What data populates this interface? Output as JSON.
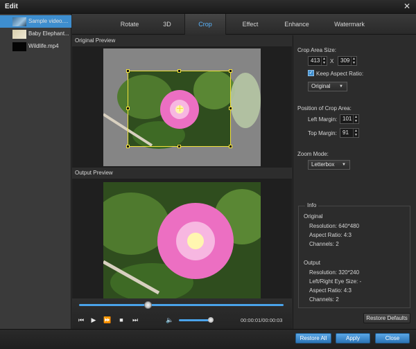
{
  "window": {
    "title": "Edit"
  },
  "files": [
    {
      "name": "Sample video....",
      "selected": true
    },
    {
      "name": "Baby Elephant...",
      "selected": false
    },
    {
      "name": "Wildlife.mp4",
      "selected": false
    }
  ],
  "tabs": [
    "Rotate",
    "3D",
    "Crop",
    "Effect",
    "Enhance",
    "Watermark"
  ],
  "preview": {
    "original_label": "Original Preview",
    "output_label": "Output Preview"
  },
  "player": {
    "time": "00:00:01/00:00:03",
    "progress": 0.33,
    "volume": 0.9
  },
  "crop": {
    "size_label": "Crop Area Size:",
    "width": "413",
    "x_sep": "X",
    "height": "309",
    "keep_aspect_label": "Keep Aspect Ratio:",
    "keep_aspect_checked": true,
    "aspect_mode": "Original",
    "position_label": "Position of Crop Area:",
    "left_margin_label": "Left Margin:",
    "left_margin": "101",
    "top_margin_label": "Top Margin:",
    "top_margin": "91",
    "zoom_label": "Zoom Mode:",
    "zoom_mode": "Letterbox"
  },
  "info": {
    "title": "Info",
    "original_head": "Original",
    "original_resolution": "Resolution: 640*480",
    "original_aspect": "Aspect Ratio: 4:3",
    "original_channels": "Channels: 2",
    "output_head": "Output",
    "output_resolution": "Resolution: 320*240",
    "output_eye": "Left/Right Eye Size: -",
    "output_aspect": "Aspect Ratio: 4:3",
    "output_channels": "Channels: 2"
  },
  "buttons": {
    "restore_defaults": "Restore Defaults",
    "restore_all": "Restore All",
    "apply": "Apply",
    "close": "Close"
  },
  "colors": {
    "accent": "#3e8ecf",
    "active_tab": "#5bb6ff",
    "crop_frame": "#f3e23a"
  }
}
